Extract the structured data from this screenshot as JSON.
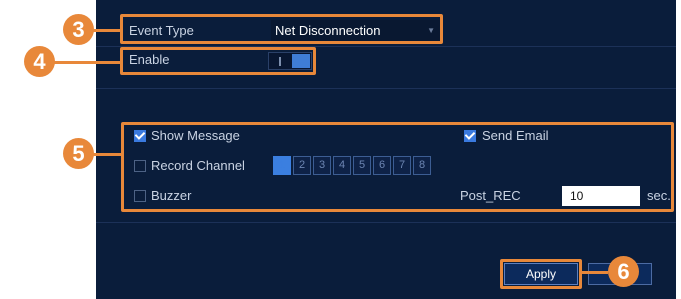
{
  "event_type": {
    "label": "Event Type",
    "value": "Net Disconnection"
  },
  "enable": {
    "label": "Enable",
    "state": "on"
  },
  "options": {
    "show_message": {
      "label": "Show Message",
      "checked": true
    },
    "send_email": {
      "label": "Send Email",
      "checked": true
    },
    "record_channel": {
      "label": "Record Channel",
      "checked": false,
      "channels": [
        "1",
        "2",
        "3",
        "4",
        "5",
        "6",
        "7",
        "8"
      ],
      "selected_channel": "1"
    },
    "buzzer": {
      "label": "Buzzer",
      "checked": false
    },
    "post_rec": {
      "label": "Post_REC",
      "value": "10",
      "unit": "sec."
    }
  },
  "apply_button": {
    "label": "Apply"
  },
  "callouts": [
    "3",
    "4",
    "5",
    "6"
  ],
  "colors": {
    "panel": "#0a1d3b",
    "accent": "#e8883a",
    "checkbox": "#3a7ae0"
  }
}
